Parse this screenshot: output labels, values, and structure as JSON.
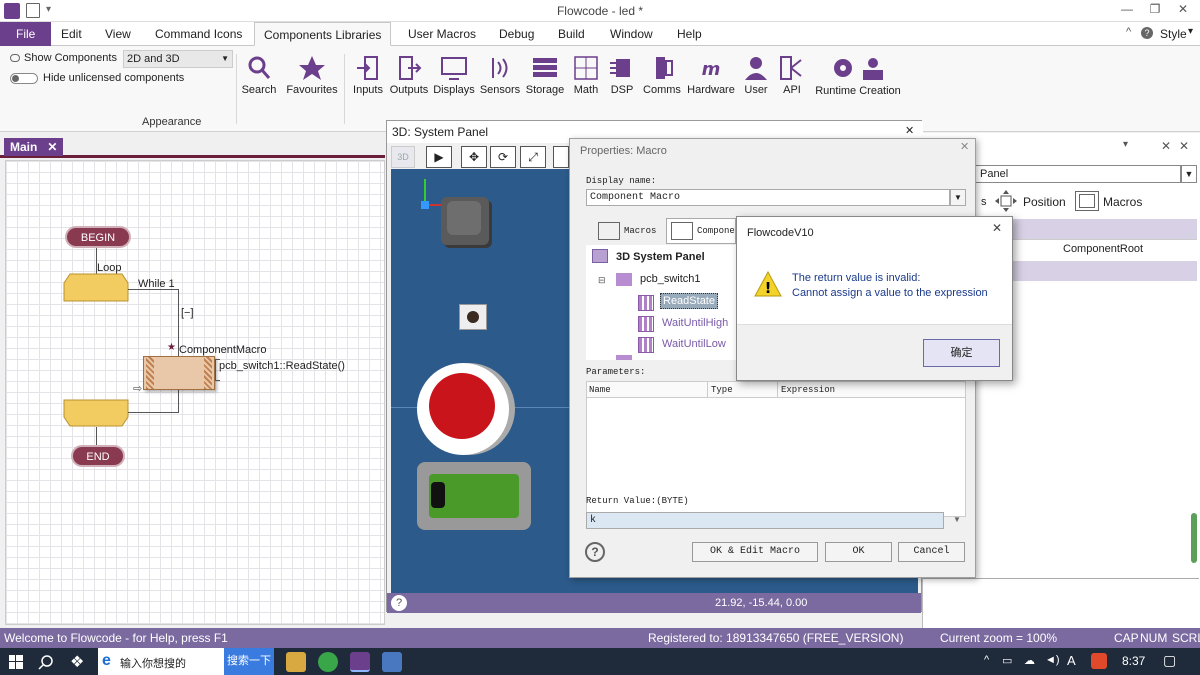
{
  "window": {
    "title": "Flowcode - led *"
  },
  "menu": [
    "File",
    "Edit",
    "View",
    "Command Icons",
    "Components Libraries",
    "User Macros",
    "Debug",
    "Build",
    "Window",
    "Help"
  ],
  "style_label": "Style",
  "ribbon": {
    "show_components_label": "Show Components",
    "show_components_value": "2D and 3D",
    "hide_unlicensed_label": "Hide unlicensed components",
    "appearance_label": "Appearance",
    "buttons": [
      "Search",
      "Favourites",
      "Inputs",
      "Outputs",
      "Displays",
      "Sensors",
      "Storage",
      "Math",
      "DSP",
      "Comms",
      "Hardware",
      "User",
      "API",
      "Runtime Creation"
    ]
  },
  "tab_main": "Main",
  "flowchart": {
    "begin": "BEGIN",
    "loop": "Loop",
    "while": "While 1",
    "collapse": "[−]",
    "component_macro": "ComponentMacro",
    "call": "pcb_switch1::ReadState()",
    "end": "END"
  },
  "panel3d": {
    "title": "3D: System Panel",
    "coords": "21.92, -15.44, 0.00"
  },
  "props": {
    "title": "Properties: Macro",
    "display_name_label": "Display name:",
    "display_name_value": "Component Macro",
    "tab_macros": "Macros",
    "tab_components": "Components",
    "tree_root": "3D System Panel",
    "tree_child": "pcb_switch1",
    "tree_items": [
      "ReadState",
      "WaitUntilHigh",
      "WaitUntilLow"
    ],
    "parameters_label": "Parameters:",
    "col_name": "Name",
    "col_type": "Type",
    "col_expression": "Expression",
    "return_label": "Return Value:(BYTE)",
    "return_value": "k",
    "ok_edit": "OK & Edit Macro",
    "ok": "OK",
    "cancel": "Cancel"
  },
  "msgbox": {
    "title": "FlowcodeV10",
    "line1": "The return value is invalid:",
    "line2": "Cannot assign a value to the expression",
    "ok": "确定"
  },
  "right_panel": {
    "field": "Panel",
    "position": "Position",
    "macros": "Macros",
    "component_root": "ComponentRoot"
  },
  "statusbar": {
    "welcome": "Welcome to Flowcode - for Help, press F1",
    "registered": "Registered to: 18913347650 (FREE_VERSION)",
    "zoom": "Current zoom = 100%",
    "cap": "CAP",
    "num": "NUM",
    "scrl": "SCRL"
  },
  "taskbar": {
    "search_text": "输入你想搜的",
    "search_button": "搜索一下",
    "ime": "A",
    "time": "8:37"
  },
  "colors": {
    "accent": "#6b3f8c",
    "status": "#7b6aa0",
    "macro_bg": "#e8c8a8"
  }
}
